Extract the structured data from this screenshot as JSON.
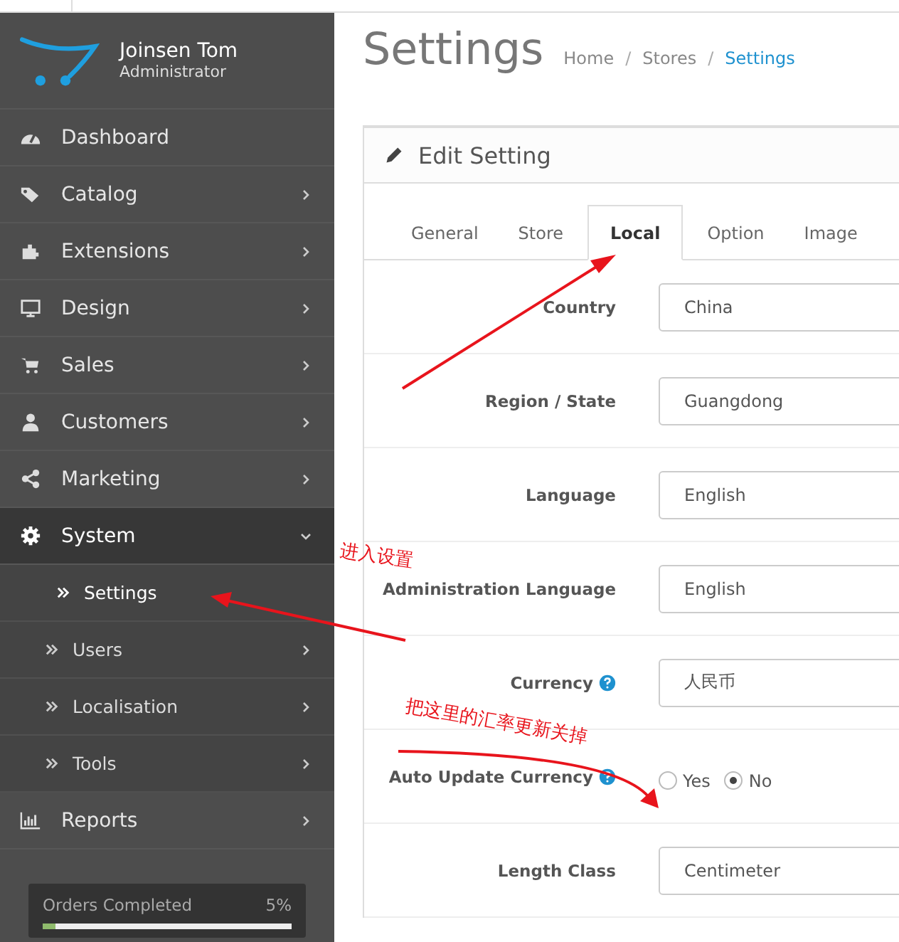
{
  "profile": {
    "name": "Joinsen Tom",
    "role": "Administrator"
  },
  "menu": [
    {
      "label": "Dashboard",
      "kind": "link",
      "expanded": false
    },
    {
      "label": "Catalog",
      "kind": "menu",
      "expanded": false
    },
    {
      "label": "Extensions",
      "kind": "menu",
      "expanded": false
    },
    {
      "label": "Design",
      "kind": "menu",
      "expanded": false
    },
    {
      "label": "Sales",
      "kind": "menu",
      "expanded": false
    },
    {
      "label": "Customers",
      "kind": "menu",
      "expanded": false
    },
    {
      "label": "Marketing",
      "kind": "menu",
      "expanded": false
    },
    {
      "label": "System",
      "kind": "menu",
      "expanded": true,
      "children": [
        {
          "label": "Settings",
          "kind": "link",
          "selected": true
        },
        {
          "label": "Users",
          "kind": "menu",
          "selected": false
        },
        {
          "label": "Localisation",
          "kind": "menu",
          "selected": false
        },
        {
          "label": "Tools",
          "kind": "menu",
          "selected": false
        }
      ]
    },
    {
      "label": "Reports",
      "kind": "menu",
      "expanded": false
    }
  ],
  "progress": {
    "label": "Orders Completed",
    "reading": "5%",
    "level": 0.05
  },
  "page_title": "Settings",
  "breadcrumb": [
    {
      "label": "Home",
      "selected": false
    },
    {
      "separator": "/",
      "label": "Stores",
      "selected": false
    },
    {
      "separator": "/",
      "label": "Settings",
      "selected": true
    }
  ],
  "panel_title": "Edit Setting",
  "tabs": [
    {
      "label": "General",
      "selected": false
    },
    {
      "label": "Store",
      "selected": false
    },
    {
      "label": "Local",
      "selected": true
    },
    {
      "label": "Option",
      "selected": false
    },
    {
      "label": "Image",
      "selected": false
    }
  ],
  "fields": [
    {
      "label": "Country",
      "kind": "select",
      "help": false,
      "value": "China"
    },
    {
      "label": "Region / State",
      "kind": "select",
      "help": false,
      "value": "Guangdong"
    },
    {
      "label": "Language",
      "kind": "select",
      "help": false,
      "value": "English"
    },
    {
      "label": "Administration Language",
      "kind": "select",
      "help": false,
      "value": "English"
    },
    {
      "label": "Currency",
      "kind": "select",
      "help": true,
      "value": "人民币"
    },
    {
      "label": "Auto Update Currency",
      "kind": "radio",
      "help": true,
      "options": [
        {
          "label": "Yes",
          "selected": false
        },
        {
          "label": "No",
          "selected": true
        }
      ]
    },
    {
      "label": "Length Class",
      "kind": "select",
      "help": false,
      "value": "Centimeter"
    }
  ],
  "annotations": [
    {
      "text": "进入设置"
    },
    {
      "text": "把这里的汇率更新关掉"
    }
  ]
}
